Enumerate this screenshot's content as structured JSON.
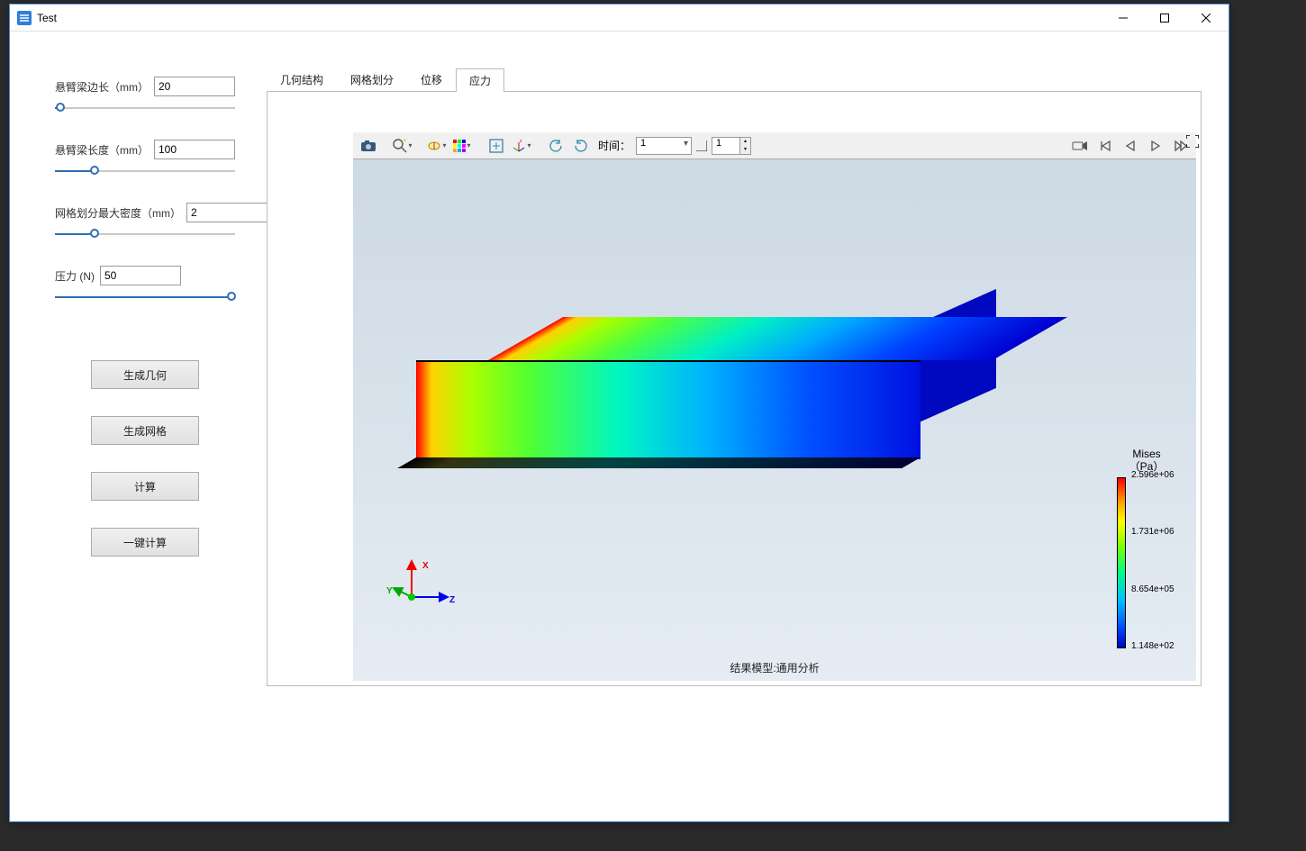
{
  "window": {
    "title": "Test"
  },
  "sidebar": {
    "fields": [
      {
        "label": "悬臂梁边长（mm）",
        "value": "20",
        "pct": 3
      },
      {
        "label": "悬臂梁长度（mm）",
        "value": "100",
        "pct": 22
      },
      {
        "label": "网格划分最大密度（mm）",
        "value": "2",
        "pct": 22
      },
      {
        "label": "压力 (N)",
        "value": "50",
        "pct": 98
      }
    ],
    "buttons": [
      "生成几何",
      "生成网格",
      "计算",
      "一键计算"
    ]
  },
  "tabs": {
    "items": [
      "几何结构",
      "网格划分",
      "位移",
      "应力"
    ],
    "active": 3
  },
  "toolbar": {
    "time_label": "时间：",
    "time_value": "1",
    "step_value": "1"
  },
  "colorbar": {
    "title_line1": "Mises",
    "title_line2": "（Pa）",
    "ticks": [
      "2.596e+06",
      "1.731e+06",
      "8.654e+05",
      "1.148e+02"
    ]
  },
  "result_label": "结果模型:通用分析",
  "axes": {
    "x": "X",
    "y": "Y",
    "z": "Z"
  }
}
